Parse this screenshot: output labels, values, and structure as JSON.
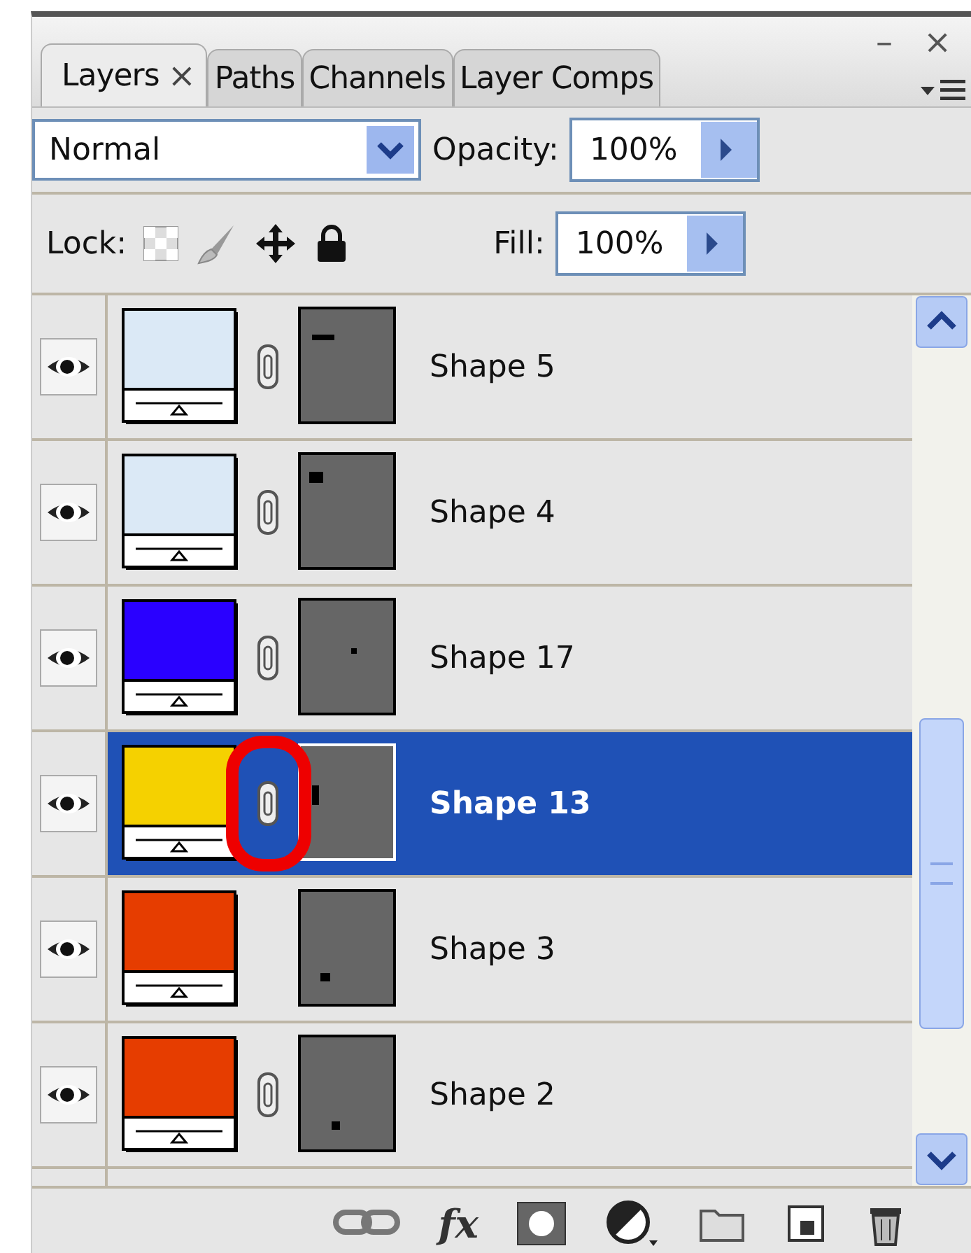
{
  "panel": {
    "minimize": "–",
    "close": "×"
  },
  "tabs": [
    {
      "label": "Layers",
      "selected": true,
      "closable": true
    },
    {
      "label": "Paths",
      "selected": false,
      "closable": false
    },
    {
      "label": "Channels",
      "selected": false,
      "closable": false
    },
    {
      "label": "Layer Comps",
      "selected": false,
      "closable": false
    }
  ],
  "blend_mode": "Normal",
  "opacity": {
    "label": "Opacity:",
    "value": "100%"
  },
  "lock": {
    "label": "Lock:"
  },
  "fill": {
    "label": "Fill:",
    "value": "100%"
  },
  "layers": [
    {
      "name": "Shape 5",
      "color": "#dbe9f6",
      "visible": true,
      "linked": true,
      "selected": false,
      "highlighted": false
    },
    {
      "name": "Shape 4",
      "color": "#dbe9f6",
      "visible": true,
      "linked": true,
      "selected": false,
      "highlighted": false
    },
    {
      "name": "Shape 17",
      "color": "#2a00ff",
      "visible": true,
      "linked": true,
      "selected": false,
      "highlighted": false
    },
    {
      "name": "Shape 13",
      "color": "#f5d100",
      "visible": true,
      "linked": true,
      "selected": true,
      "highlighted": true
    },
    {
      "name": "Shape 3",
      "color": "#e63d00",
      "visible": true,
      "linked": false,
      "selected": false,
      "highlighted": false
    },
    {
      "name": "Shape 2",
      "color": "#e63d00",
      "visible": true,
      "linked": true,
      "selected": false,
      "highlighted": false
    }
  ],
  "toolbar": {
    "fx": "fx"
  }
}
